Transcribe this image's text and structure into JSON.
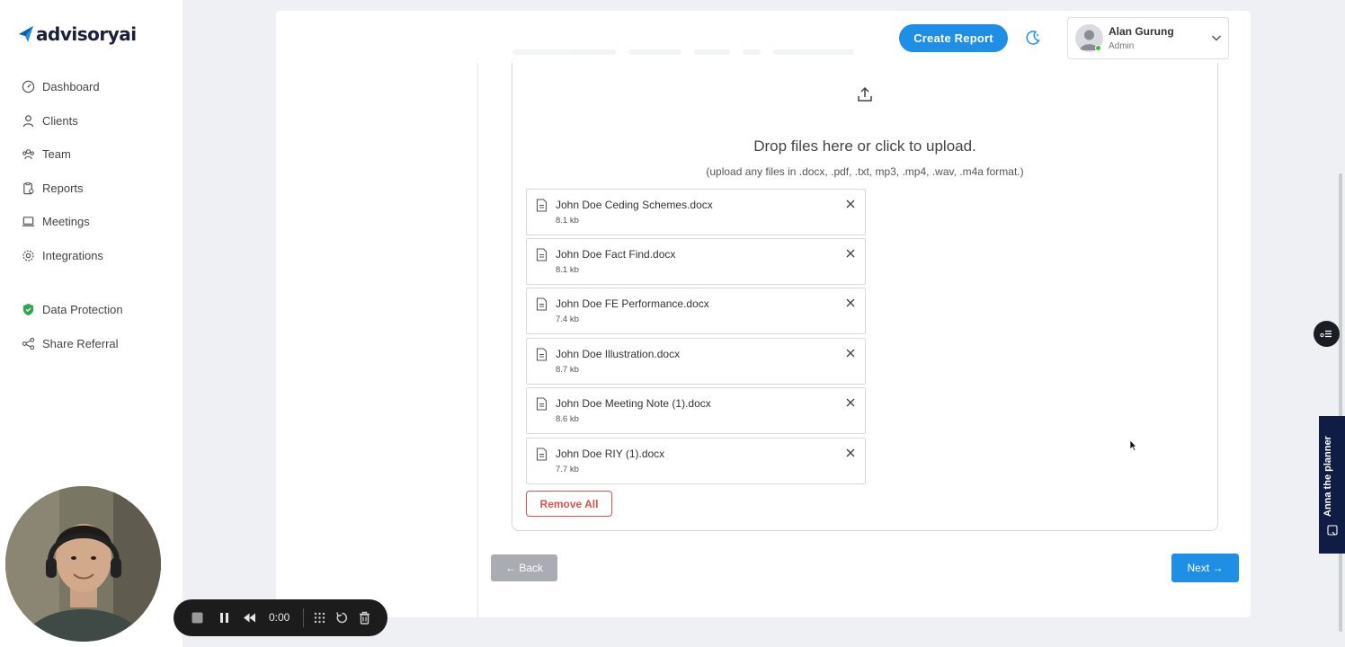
{
  "brand": {
    "name": "advisoryai",
    "accent": "#1f8fe5"
  },
  "sidebar": {
    "items": [
      {
        "label": "Dashboard",
        "icon": "dashboard-icon"
      },
      {
        "label": "Clients",
        "icon": "user-icon"
      },
      {
        "label": "Team",
        "icon": "team-icon"
      },
      {
        "label": "Reports",
        "icon": "reports-icon"
      },
      {
        "label": "Meetings",
        "icon": "laptop-icon"
      },
      {
        "label": "Integrations",
        "icon": "gear-icon"
      }
    ],
    "secondary": [
      {
        "label": "Data Protection",
        "icon": "shield-icon"
      },
      {
        "label": "Share Referral",
        "icon": "share-icon"
      }
    ]
  },
  "header": {
    "create_label": "Create Report",
    "user": {
      "name": "Alan Gurung",
      "role": "Admin"
    }
  },
  "upload": {
    "title": "Drop files here or click to upload.",
    "subtitle": "(upload any files in .docx, .pdf, .txt, mp3, .mp4, .wav, .m4a format.)",
    "files": [
      {
        "name": "John Doe Ceding Schemes.docx",
        "size": "8.1 kb"
      },
      {
        "name": "John Doe Fact Find.docx",
        "size": "8.1 kb"
      },
      {
        "name": "John Doe FE Performance.docx",
        "size": "7.4 kb"
      },
      {
        "name": "John Doe Illustration.docx",
        "size": "8.7 kb"
      },
      {
        "name": "John Doe Meeting Note (1).docx",
        "size": "8.6 kb"
      },
      {
        "name": "John Doe RIY (1).docx",
        "size": "7.7 kb"
      }
    ],
    "remove_all_label": "Remove All"
  },
  "footer": {
    "back_label": "← Back",
    "next_label": "Next →"
  },
  "side_tab": {
    "label": "Anna the planner"
  },
  "recorder": {
    "time": "0:00"
  }
}
